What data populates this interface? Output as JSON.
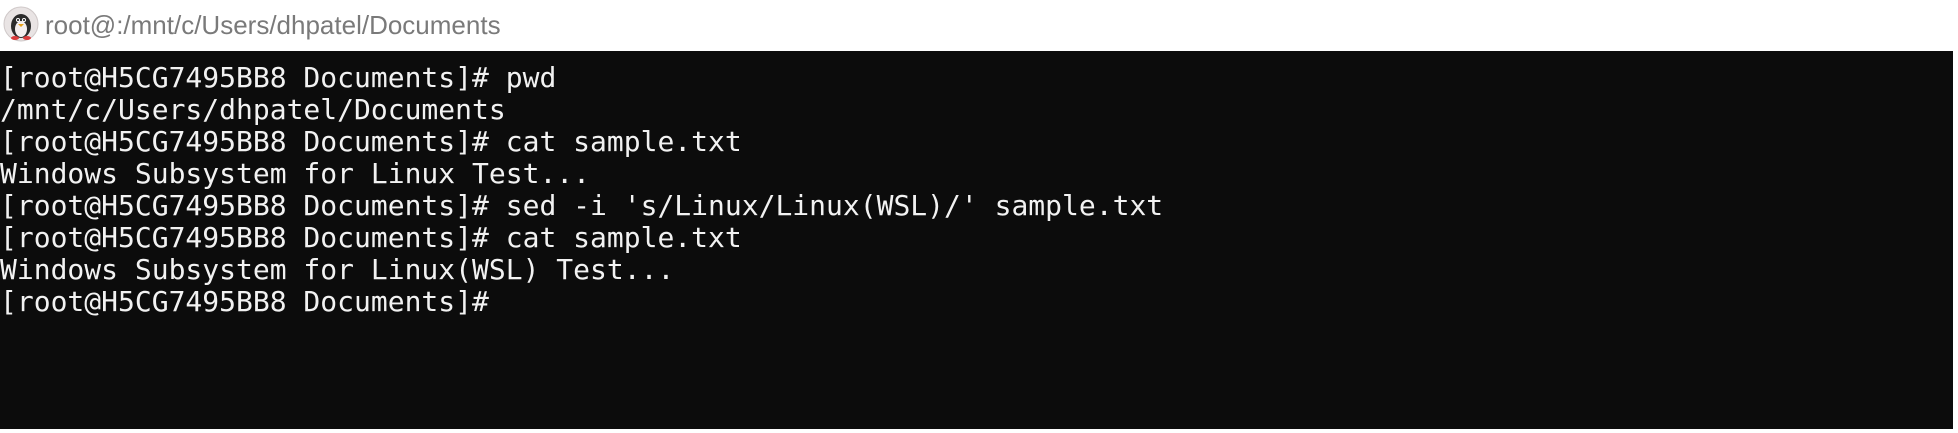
{
  "window": {
    "title": "root@:/mnt/c/Users/dhpatel/Documents",
    "icon": "penguin-avatar-icon"
  },
  "terminal": {
    "lines": [
      "[root@H5CG7495BB8 Documents]# pwd",
      "/mnt/c/Users/dhpatel/Documents",
      "[root@H5CG7495BB8 Documents]# cat sample.txt",
      "Windows Subsystem for Linux Test...",
      "[root@H5CG7495BB8 Documents]# sed -i 's/Linux/Linux(WSL)/' sample.txt",
      "[root@H5CG7495BB8 Documents]# cat sample.txt",
      "Windows Subsystem for Linux(WSL) Test...",
      "[root@H5CG7495BB8 Documents]#"
    ]
  },
  "colors": {
    "terminal_background": "#0c0c0c",
    "terminal_text": "#f2f2f2",
    "title_text": "#7a7a7a"
  }
}
